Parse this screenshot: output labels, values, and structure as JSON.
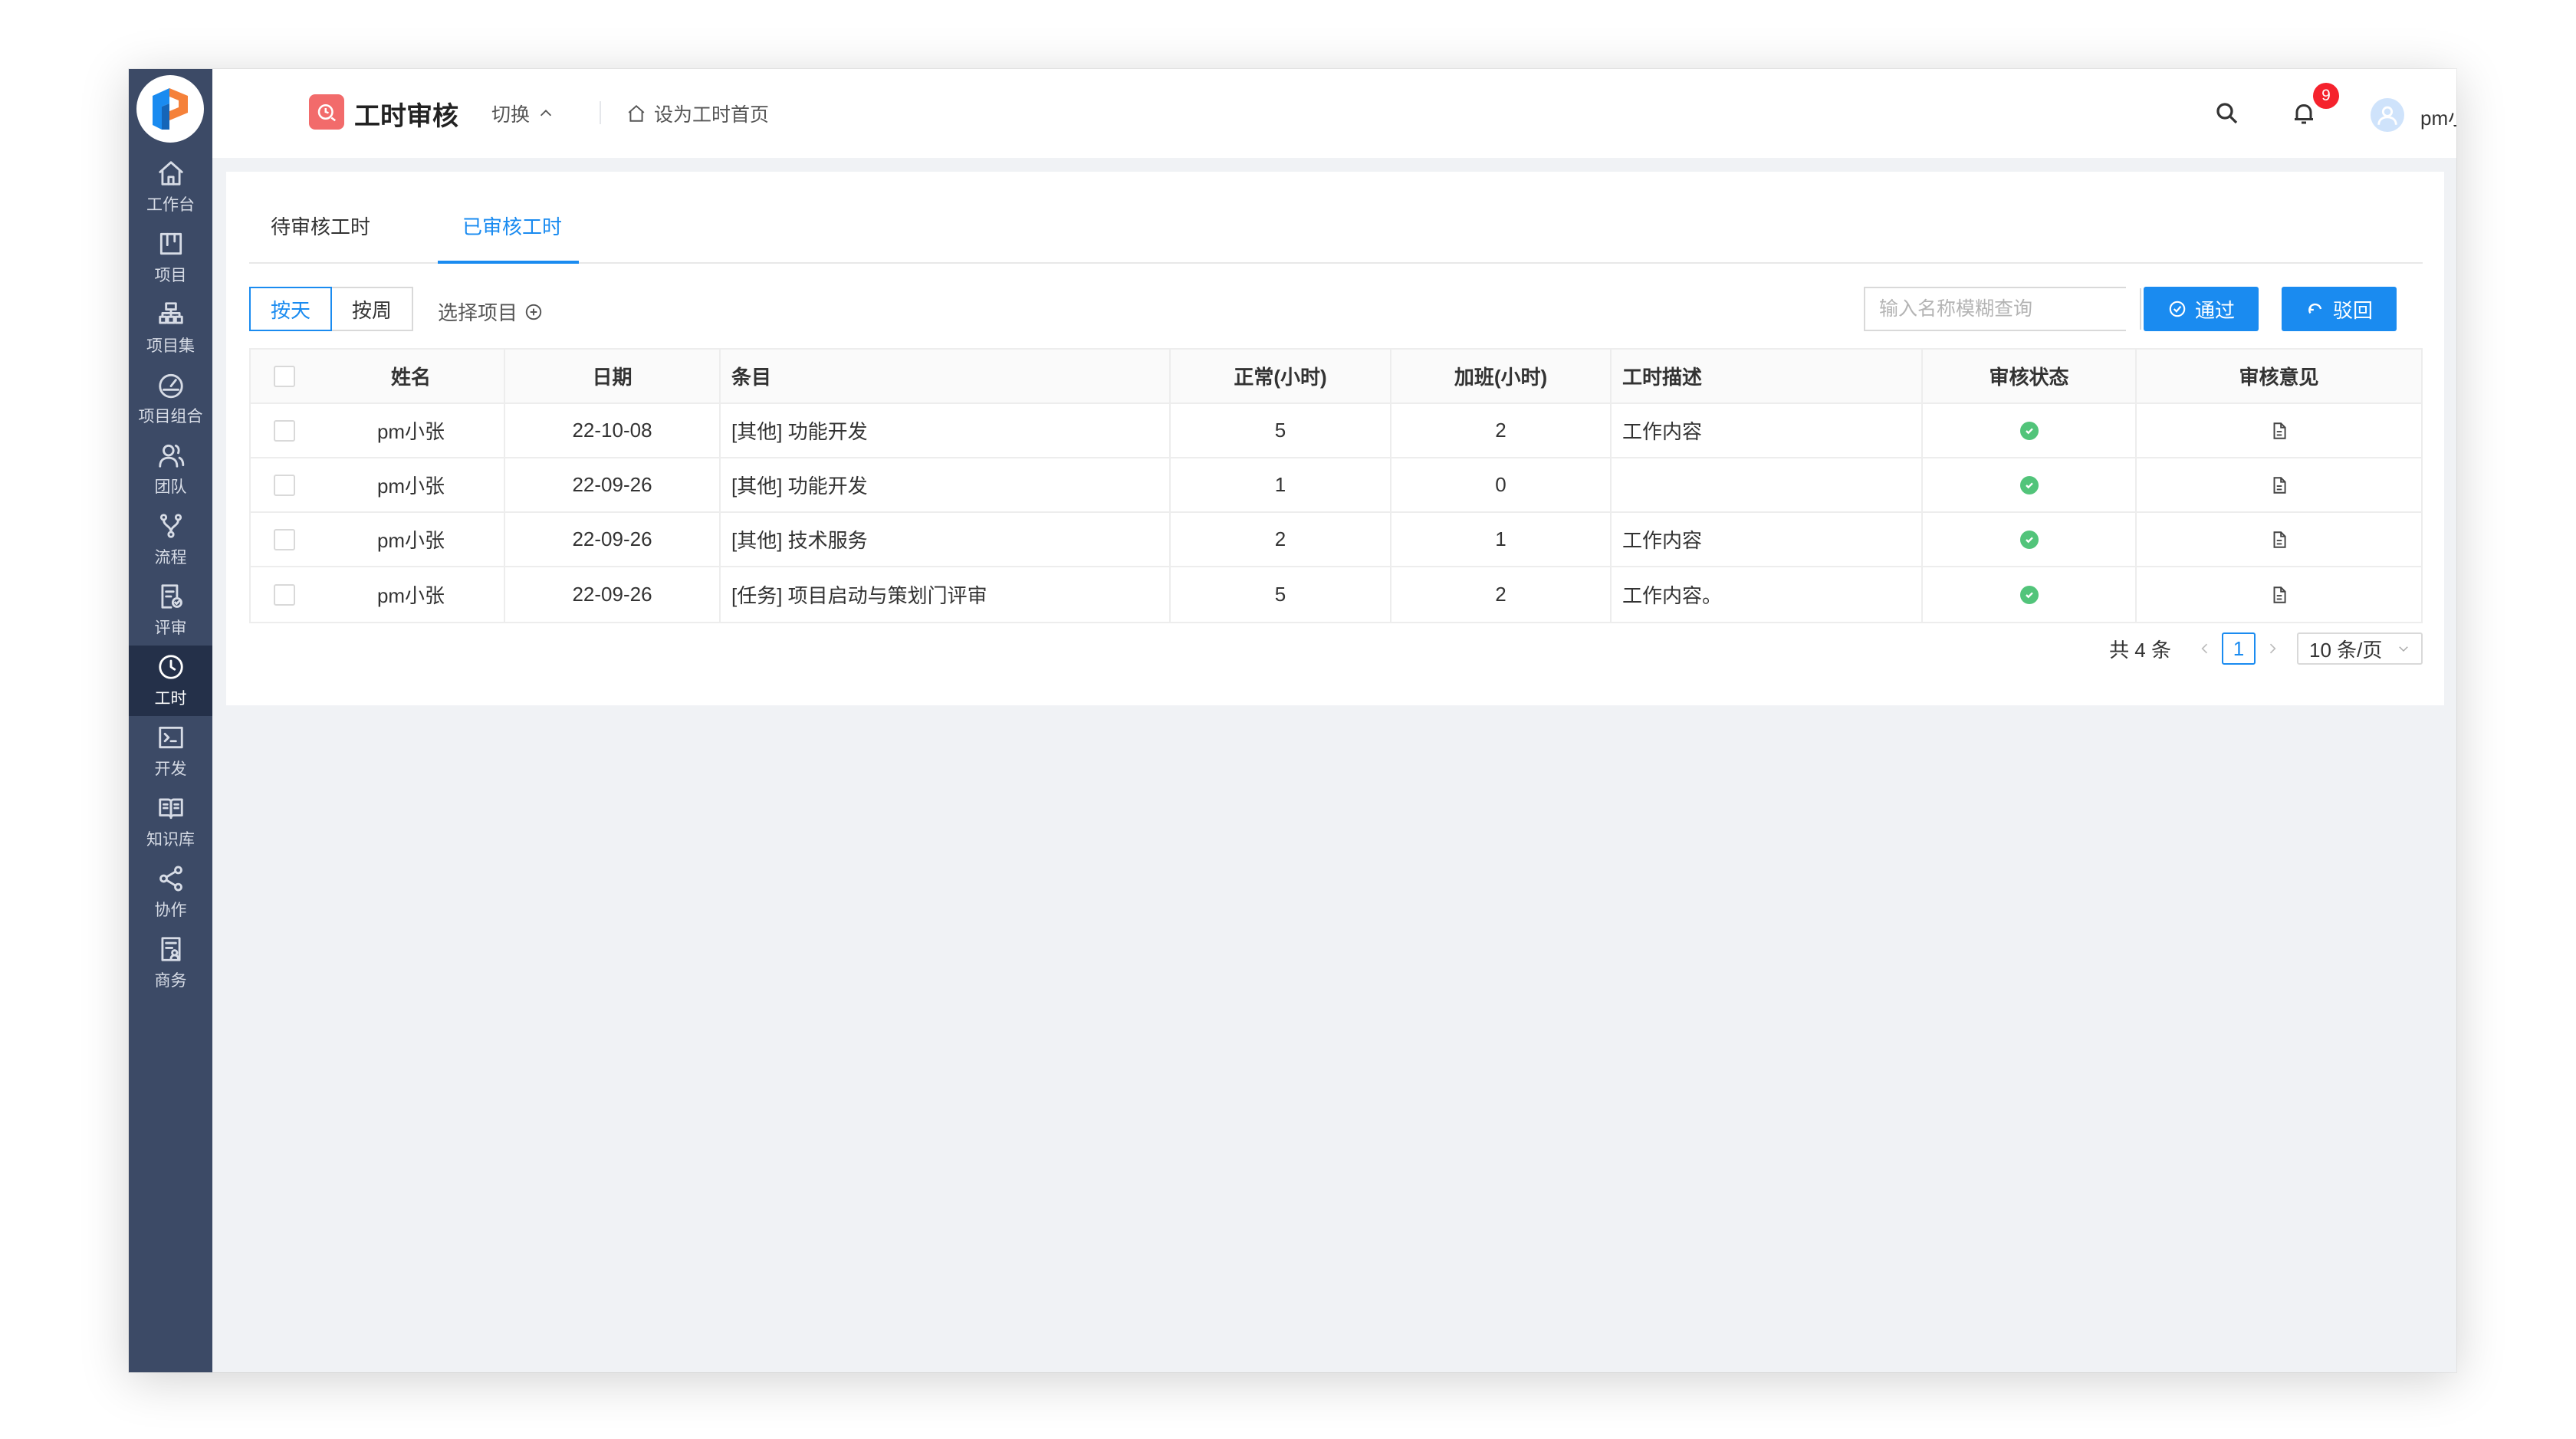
{
  "sidebar": {
    "items": [
      {
        "label": "工作台",
        "icon": "home-icon"
      },
      {
        "label": "项目",
        "icon": "project-board-icon"
      },
      {
        "label": "项目集",
        "icon": "program-hierarchy-icon"
      },
      {
        "label": "项目组合",
        "icon": "portfolio-gauge-icon"
      },
      {
        "label": "团队",
        "icon": "team-icon"
      },
      {
        "label": "流程",
        "icon": "workflow-branch-icon"
      },
      {
        "label": "评审",
        "icon": "review-document-icon"
      },
      {
        "label": "工时",
        "icon": "clock-icon",
        "active": true
      },
      {
        "label": "开发",
        "icon": "terminal-icon"
      },
      {
        "label": "知识库",
        "icon": "book-icon"
      },
      {
        "label": "协作",
        "icon": "share-icon"
      },
      {
        "label": "商务",
        "icon": "business-document-icon"
      }
    ]
  },
  "header": {
    "app_title": "工时审核",
    "switch_label": "切换",
    "set_home_label": "设为工时首页",
    "notification_count": "9",
    "user_name": "pm小张"
  },
  "tabs": [
    {
      "label": "待审核工时",
      "active": false
    },
    {
      "label": "已审核工时",
      "active": true
    }
  ],
  "toolbar": {
    "by_day": "按天",
    "by_week": "按周",
    "select_project": "选择项目",
    "search_placeholder": "输入名称模糊查询",
    "approve_label": "通过",
    "reject_label": "驳回"
  },
  "table": {
    "columns": [
      "姓名",
      "日期",
      "条目",
      "正常(小时)",
      "加班(小时)",
      "工时描述",
      "审核状态",
      "审核意见"
    ],
    "rows": [
      {
        "name": "pm小张",
        "date": "22-10-08",
        "item": "[其他] 功能开发",
        "normal": "5",
        "overtime": "2",
        "desc": "工作内容",
        "status": "approved"
      },
      {
        "name": "pm小张",
        "date": "22-09-26",
        "item": "[其他] 功能开发",
        "normal": "1",
        "overtime": "0",
        "desc": "",
        "status": "approved"
      },
      {
        "name": "pm小张",
        "date": "22-09-26",
        "item": "[其他] 技术服务",
        "normal": "2",
        "overtime": "1",
        "desc": "工作内容",
        "status": "approved"
      },
      {
        "name": "pm小张",
        "date": "22-09-26",
        "item": "[任务] 项目启动与策划门评审",
        "normal": "5",
        "overtime": "2",
        "desc": "工作内容。",
        "status": "approved"
      }
    ]
  },
  "pagination": {
    "total": "共 4 条",
    "current_page": "1",
    "page_size": "10 条/页"
  },
  "colors": {
    "accent": "#1a8bf0",
    "sidebar": "#3c4a66",
    "sidebar_active": "#243049",
    "status_approved": "#52c47a",
    "badge": "#f5222d"
  }
}
